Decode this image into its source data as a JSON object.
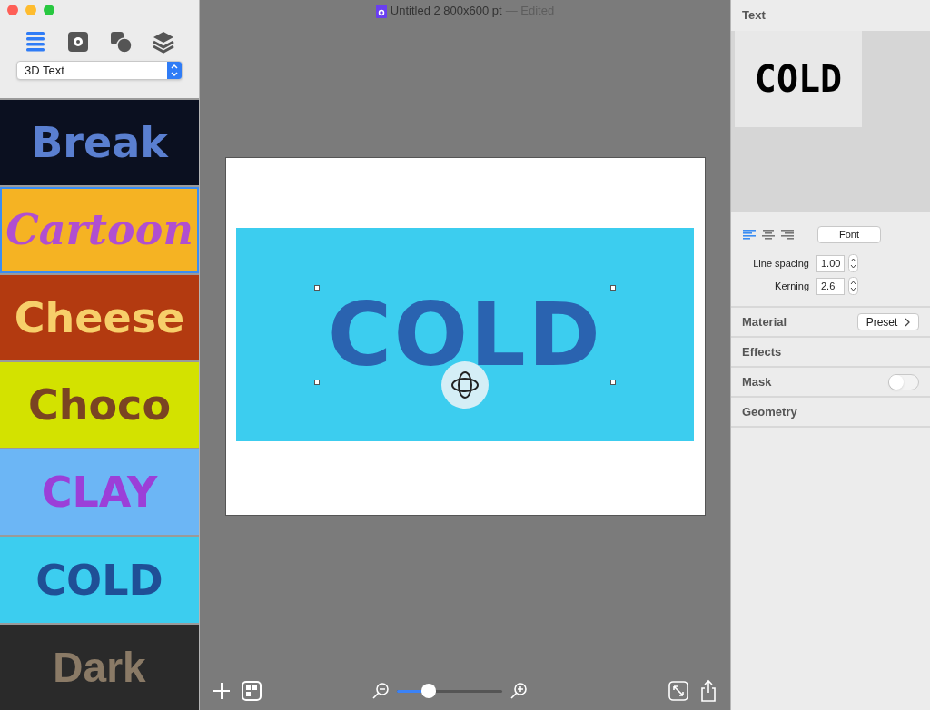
{
  "window": {
    "title": "Untitled 2 800x600 pt",
    "status": "— Edited"
  },
  "sidebar": {
    "tabs": [
      {
        "kind": "list",
        "selected": true
      },
      {
        "kind": "gear",
        "selected": false
      },
      {
        "kind": "shapes",
        "selected": false
      },
      {
        "kind": "layers",
        "selected": false
      }
    ],
    "category": "3D Text",
    "presets": [
      {
        "label": "Break",
        "kind": "break",
        "selected": false
      },
      {
        "label": "Cartoon",
        "kind": "cartoon",
        "selected": true
      },
      {
        "label": "Cheese",
        "kind": "cheese",
        "selected": false
      },
      {
        "label": "Choco",
        "kind": "choco",
        "selected": false
      },
      {
        "label": "CLAY",
        "kind": "clay",
        "selected": false
      },
      {
        "label": "COLD",
        "kind": "cold",
        "selected": false
      },
      {
        "label": "Dark",
        "kind": "dark",
        "selected": false
      }
    ]
  },
  "canvas": {
    "text": "COLD",
    "zoom": {
      "level": 0.3
    }
  },
  "inspector": {
    "section": "Text",
    "preview_text": "COLD",
    "alignment": [
      {
        "kind": "left",
        "selected": true
      },
      {
        "kind": "center",
        "selected": false
      },
      {
        "kind": "right",
        "selected": false
      }
    ],
    "font_button": "Font",
    "fields": [
      {
        "label": "Line spacing",
        "value": "1.00"
      },
      {
        "label": "Kerning",
        "value": "2.6"
      }
    ],
    "sections": [
      {
        "title": "Material",
        "kind": "button",
        "button": "Preset"
      },
      {
        "title": "Effects",
        "kind": "plain"
      },
      {
        "title": "Mask",
        "kind": "toggle",
        "on": false
      },
      {
        "title": "Geometry",
        "kind": "plain"
      }
    ]
  }
}
